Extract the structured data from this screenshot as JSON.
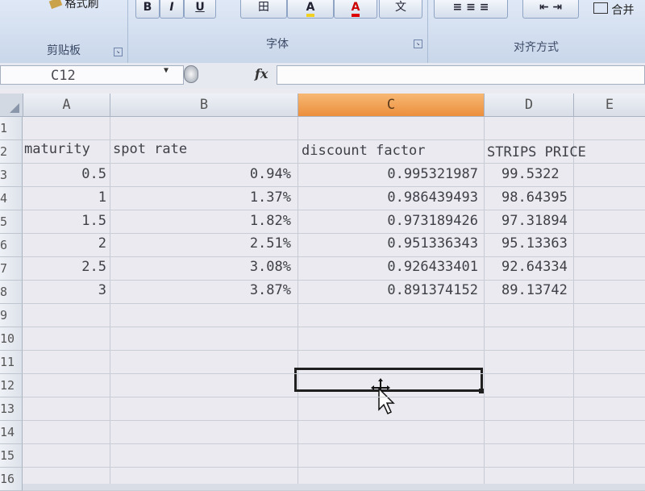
{
  "ribbon": {
    "format_painter_label": "格式刷",
    "bold_label": "B",
    "italic_label": "I",
    "underline_label": "U",
    "border_icon_label": "田",
    "fill_color_label": "A",
    "font_color_label": "A",
    "wen_label": "文",
    "merge_label": "合并",
    "groups": {
      "clipboard": "剪贴板",
      "font": "字体",
      "alignment": "对齐方式"
    }
  },
  "formula_bar": {
    "name_box": "C12",
    "fx": "fx",
    "formula": ""
  },
  "grid": {
    "columns": [
      "A",
      "B",
      "C",
      "D",
      "E"
    ],
    "selected_column": "C",
    "row_numbers": [
      "1",
      "2",
      "3",
      "4",
      "5",
      "6",
      "7",
      "8",
      "9",
      "10",
      "11",
      "12",
      "13",
      "14",
      "15",
      "16"
    ],
    "headers": {
      "a": "maturity",
      "b": "spot rate",
      "c": "discount factor",
      "d": "STRIPS PRICE"
    },
    "rows": [
      {
        "maturity": "0.5",
        "spot_rate": "0.94%",
        "discount_factor": "0.995321987",
        "strips_price": "99.5322"
      },
      {
        "maturity": "1",
        "spot_rate": "1.37%",
        "discount_factor": "0.986439493",
        "strips_price": "98.64395"
      },
      {
        "maturity": "1.5",
        "spot_rate": "1.82%",
        "discount_factor": "0.973189426",
        "strips_price": "97.31894"
      },
      {
        "maturity": "2",
        "spot_rate": "2.51%",
        "discount_factor": "0.951336343",
        "strips_price": "95.13363"
      },
      {
        "maturity": "2.5",
        "spot_rate": "3.08%",
        "discount_factor": "0.926433401",
        "strips_price": "92.64334"
      },
      {
        "maturity": "3",
        "spot_rate": "3.87%",
        "discount_factor": "0.891374152",
        "strips_price": "89.13742"
      }
    ],
    "active_cell": "C12"
  },
  "colors": {
    "selected_column_header": "#ec8f3c",
    "ribbon_bg": "#c9d7ea"
  }
}
